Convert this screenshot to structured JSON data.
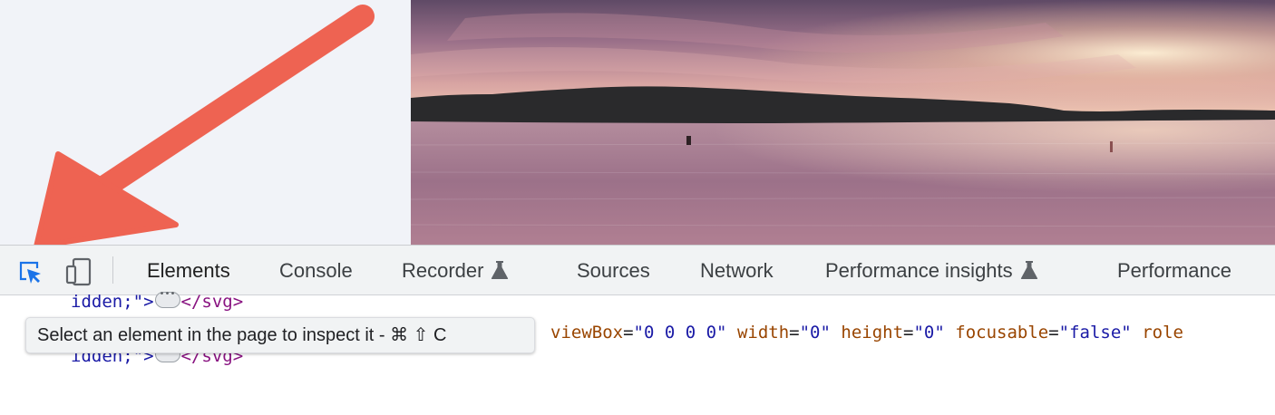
{
  "devtools": {
    "toolbar": {
      "tabs": [
        {
          "label": "Elements",
          "active": true,
          "experimental": false
        },
        {
          "label": "Console",
          "active": false,
          "experimental": false
        },
        {
          "label": "Recorder",
          "active": false,
          "experimental": true
        },
        {
          "label": "Sources",
          "active": false,
          "experimental": false
        },
        {
          "label": "Network",
          "active": false,
          "experimental": false
        },
        {
          "label": "Performance insights",
          "active": false,
          "experimental": true
        },
        {
          "label": "Performance",
          "active": false,
          "experimental": false
        }
      ],
      "inspect_icon": "inspect-element-icon",
      "device_icon": "device-toolbar-icon",
      "experimental_icon": "flask-icon"
    },
    "tooltip": {
      "text": "Select an element in the page to inspect it - ⌘ ⇧ C"
    },
    "code": {
      "line1": {
        "prefix": "idden;\">",
        "suffix": "</svg>"
      },
      "line2": {
        "attr1": "viewBox",
        "val1": "\"0 0 0 0\"",
        "attr2": "width",
        "val2": "\"0\"",
        "attr3": "height",
        "val3": "\"0\"",
        "attr4": "focusable",
        "val4": "\"false\"",
        "attr5": "role"
      },
      "line3": {
        "prefix": "idden;\">",
        "suffix": "</svg>"
      }
    }
  },
  "colors": {
    "arrow": "#ee6352",
    "inspect_active": "#1a73e8",
    "toolbar_bg": "#f1f3f4",
    "page_bg": "#f1f3f8"
  }
}
